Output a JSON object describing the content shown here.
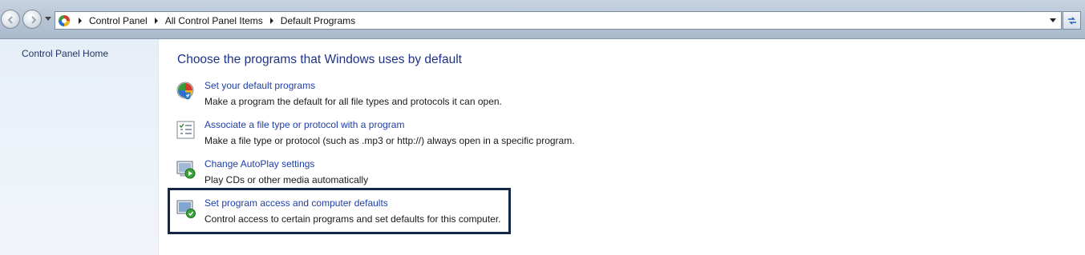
{
  "address_bar": {
    "breadcrumbs": [
      "Control Panel",
      "All Control Panel Items",
      "Default Programs"
    ],
    "address_icon": "control-panel-icon",
    "nav_icons": [
      "back-arrow-icon",
      "forward-arrow-icon",
      "recent-pages-icon",
      "address-dropdown-icon",
      "refresh-icon"
    ]
  },
  "sidebar": {
    "home_link": "Control Panel Home"
  },
  "main": {
    "title": "Choose the programs that Windows uses by default",
    "tasks": [
      {
        "icon": "default-programs-icon",
        "link": "Set your default programs",
        "description": "Make a program the default for all file types and protocols it can open."
      },
      {
        "icon": "file-association-list-icon",
        "link": "Associate a file type or protocol with a program",
        "description": "Make a file type or protocol (such as .mp3 or http://) always open in a specific program."
      },
      {
        "icon": "autoplay-icon",
        "link": "Change AutoPlay settings",
        "description": "Play CDs or other media automatically"
      },
      {
        "icon": "program-access-icon",
        "link": "Set program access and computer defaults",
        "description": "Control access to certain programs and set defaults for this computer."
      }
    ],
    "highlighted_task_index": 3
  },
  "colors": {
    "title": "#1e3287",
    "link": "#1e3ea8",
    "highlight_border": "#13284a",
    "sidebar_bg": "#e6eef8"
  }
}
